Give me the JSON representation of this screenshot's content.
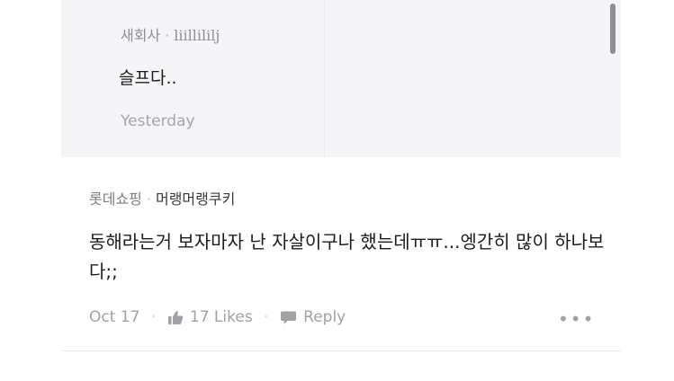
{
  "reply": {
    "company": "새회사",
    "separator": "·",
    "author": "liillililj",
    "text": "슬프다..",
    "time": "Yesterday"
  },
  "comment": {
    "company": "롯데쇼핑",
    "separator": "·",
    "author": "머랭머랭쿠키",
    "text": "동해라는거 보자마자 난 자살이구나 했는데ㅠㅠ...엥간히 많이 하나보다;;",
    "date": "Oct 17",
    "likes_label": "17 Likes",
    "reply_label": "Reply",
    "more_label": "•••",
    "dot": "·",
    "icons": [
      "thumbs-up-icon",
      "speech-bubble-icon"
    ]
  }
}
